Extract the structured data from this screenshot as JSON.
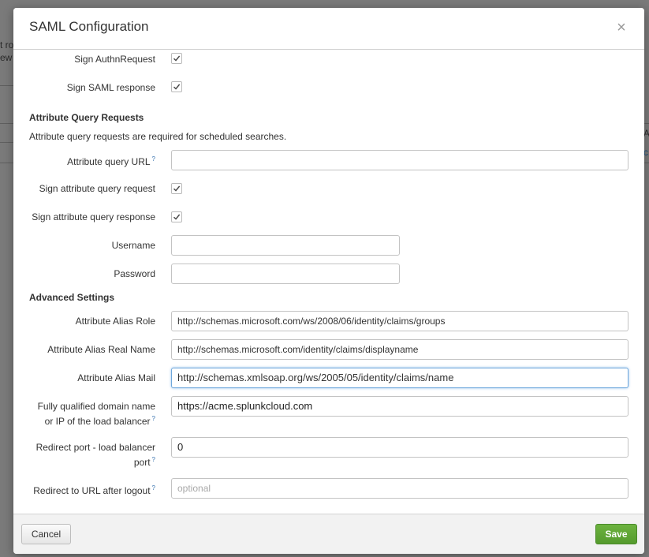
{
  "background": {
    "left_text_1": "t ro",
    "left_text_2": "ew",
    "right_text": "A",
    "right_link": "c"
  },
  "modal": {
    "title": "SAML Configuration",
    "close_icon": "close-icon"
  },
  "fields": {
    "sign_authn_request": {
      "label": "Sign AuthnRequest",
      "checked": true
    },
    "sign_saml_response": {
      "label": "Sign SAML response",
      "checked": true
    }
  },
  "attribute_query": {
    "section_title": "Attribute Query Requests",
    "description": "Attribute query requests are required for scheduled searches.",
    "url_label": "Attribute query URL",
    "url_value": "",
    "sign_request_label": "Sign attribute query request",
    "sign_request_checked": true,
    "sign_response_label": "Sign attribute query response",
    "sign_response_checked": true,
    "username_label": "Username",
    "username_value": "",
    "password_label": "Password",
    "password_value": ""
  },
  "advanced": {
    "section_title": "Advanced Settings",
    "alias_role_label": "Attribute Alias Role",
    "alias_role_value": "http://schemas.microsoft.com/ws/2008/06/identity/claims/groups",
    "alias_realname_label": "Attribute Alias Real Name",
    "alias_realname_value": "http://schemas.microsoft.com/identity/claims/displayname",
    "alias_mail_label": "Attribute Alias Mail",
    "alias_mail_value": "http://schemas.xmlsoap.org/ws/2005/05/identity/claims/name",
    "fqdn_label_line1": "Fully qualified domain name",
    "fqdn_label_line2": "or IP of the load balancer",
    "fqdn_value": "https://acme.splunkcloud.com",
    "redirect_port_label_line1": "Redirect port - load balancer",
    "redirect_port_label_line2": "port",
    "redirect_port_value": "0",
    "redirect_url_label": "Redirect to URL after logout",
    "redirect_url_placeholder": "optional"
  },
  "help_marker": "?",
  "footer": {
    "cancel_label": "Cancel",
    "save_label": "Save"
  },
  "colors": {
    "save_button": "#5ca432",
    "help_link": "#3a74b0",
    "focus_border": "#6fa8dc"
  }
}
